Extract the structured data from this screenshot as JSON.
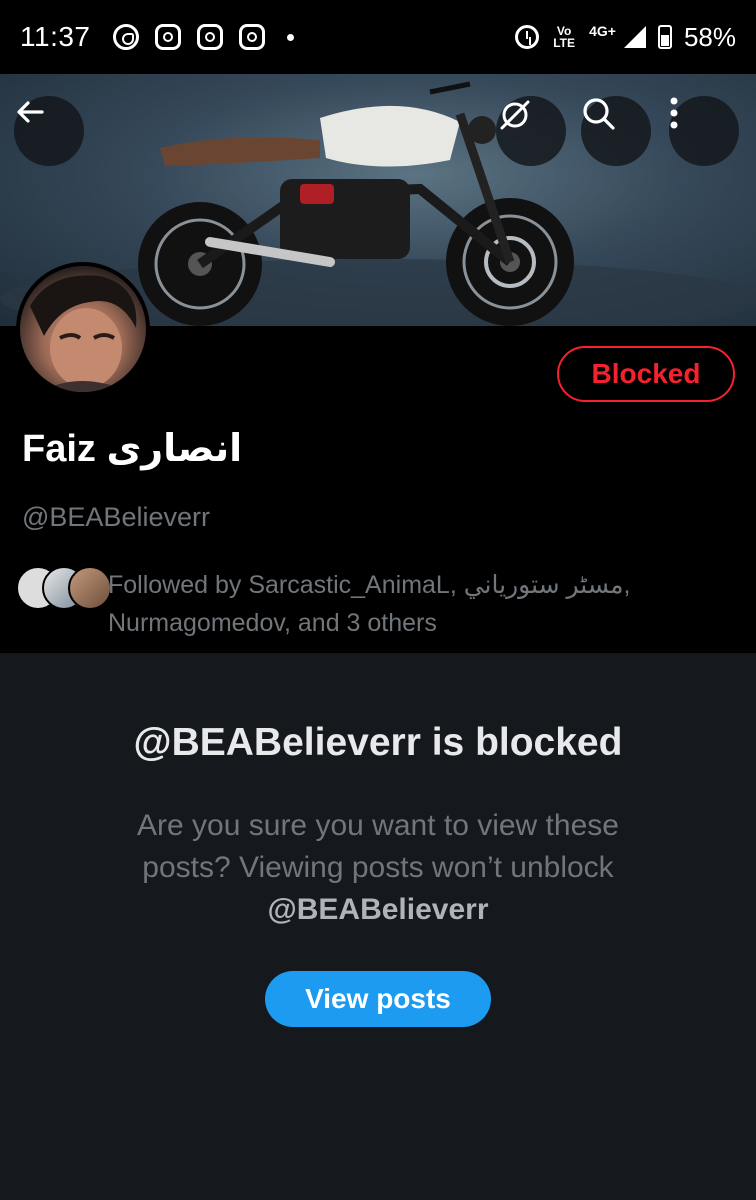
{
  "status_bar": {
    "time": "11:37",
    "notification_icons": [
      "whatsapp-icon",
      "instagram-icon",
      "instagram-icon",
      "instagram-icon"
    ],
    "volte_label": "Vo LTE",
    "network": "4G+",
    "battery": "58%"
  },
  "header": {
    "back_icon": "back-arrow-icon",
    "hide_icon": "eye-slash-icon",
    "search_icon": "search-icon",
    "more_icon": "more-vertical-icon"
  },
  "profile": {
    "display_name": "Faiz انصاری",
    "handle": "@BEABelieverr",
    "blocked_button": "Blocked",
    "followed_by": "Followed by Sarcastic_AnimaL, مسٹر ستورياني, Nurmagomedov, and 3 others"
  },
  "blocked_panel": {
    "title": "@BEABelieverr is blocked",
    "message": "Are you sure you want to view these posts? Viewing posts won’t unblock",
    "handle": "@BEABelieverr",
    "view_button": "View posts"
  },
  "colors": {
    "accent": "#1d9bf0",
    "blocked_red": "#f4212e",
    "muted_text": "#71767b",
    "panel_bg": "#15181c"
  }
}
